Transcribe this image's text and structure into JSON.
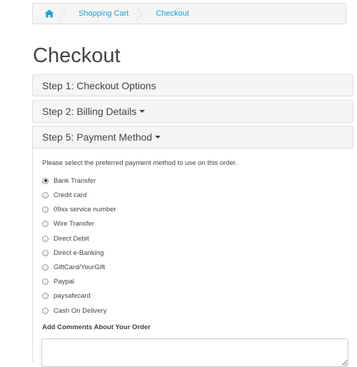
{
  "breadcrumb": {
    "items": [
      "Shopping Cart",
      "Checkout"
    ]
  },
  "page_title": "Checkout",
  "steps": [
    {
      "label": "Step 1: Checkout Options"
    },
    {
      "label": "Step 2: Billing Details"
    },
    {
      "label": "Step 5: Payment Method"
    }
  ],
  "payment": {
    "instruction": "Please select the preferred payment method to use on this order.",
    "selected": "Bank Transfer",
    "methods": [
      "Bank Transfer",
      "Credit card",
      "09xx service number",
      "Wire Transfer",
      "Direct Debit",
      "Direct e-Banking",
      "GiftCard/YourGift",
      "Paypal",
      "paysafecard",
      "Cash On Delivery"
    ]
  },
  "comments": {
    "label": "Add Comments About Your Order"
  },
  "colors": {
    "link": "#23a1d1",
    "panel_bg": "#f5f5f5",
    "border": "#dddddd"
  }
}
